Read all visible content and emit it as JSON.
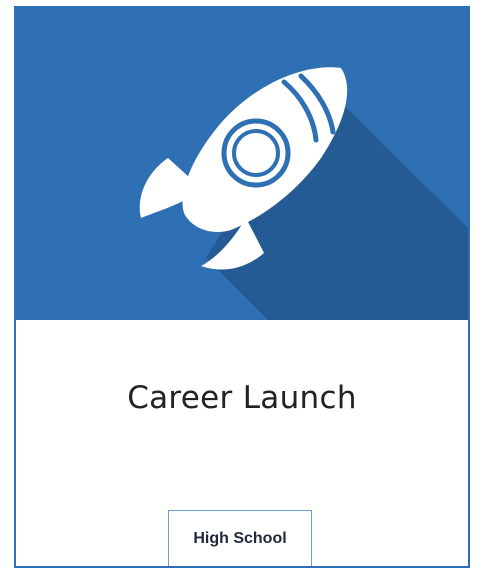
{
  "card": {
    "title": "Career Launch",
    "tag_label": "High School",
    "icon": "rocket-icon",
    "colors": {
      "hero_background": "#2f6fb3",
      "shadow": "#255a94",
      "icon_fill": "#ffffff",
      "border": "#2f6fb6"
    }
  }
}
